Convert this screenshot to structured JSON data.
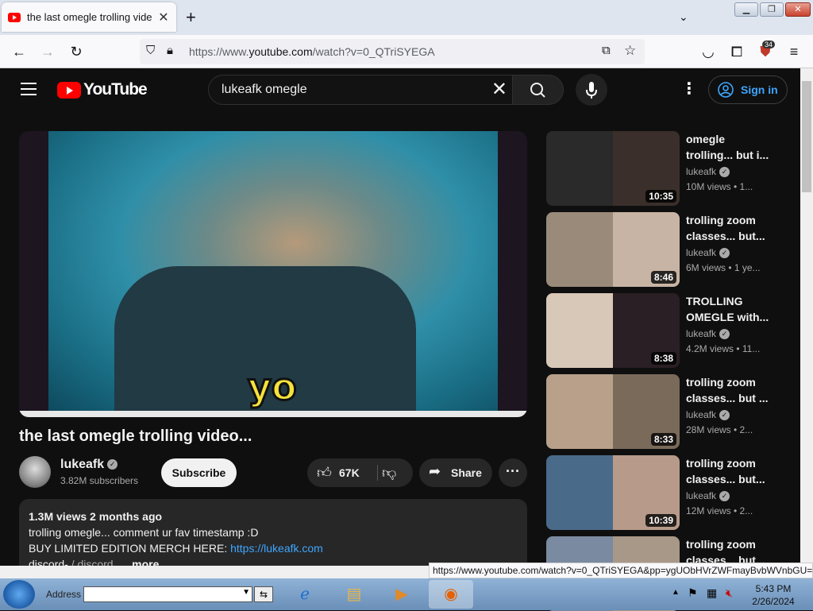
{
  "browser": {
    "tab_title": "the last omegle trolling video...",
    "url_prefix": "https://www.",
    "url_domain": "youtube.com",
    "url_rest": "/watch?v=0_QTriSYEGA",
    "extension_badge": "34",
    "status_url": "https://www.youtube.com/watch?v=0_QTriSYEGA&pp=ygUObHVrZWFmayBvbWVnbGU="
  },
  "youtube": {
    "logo_text": "YouTube",
    "search_query": "lukeafk omegle",
    "sign_in": "Sign in",
    "video": {
      "caption": "yo",
      "title": "the last omegle trolling video...",
      "channel": "lukeafk",
      "subscribers": "3.82M subscribers",
      "subscribe": "Subscribe",
      "likes": "67K",
      "share": "Share",
      "views_date": "1.3M views  2 months ago",
      "desc_line1": "trolling omegle... comment ur fav timestamp :D",
      "desc_line2_text": "BUY LIMITED EDITION MERCH HERE: ",
      "desc_line2_link": "https://lukeafk.com",
      "desc_line3": "discord- ",
      "desc_line3_link": "/ discord",
      "desc_more": "...more"
    },
    "recommendations": [
      {
        "title": "omegle trolling... but i...",
        "channel": "lukeafk",
        "stats": "10M views  • 1...",
        "duration": "10:35",
        "colors": [
          "#2a2a2a",
          "#3a2f2a"
        ]
      },
      {
        "title": "trolling zoom classes... but...",
        "channel": "lukeafk",
        "stats": "6M views  • 1 ye...",
        "duration": "8:46",
        "colors": [
          "#9a8a7a",
          "#c8b4a4"
        ]
      },
      {
        "title": "TROLLING OMEGLE with...",
        "channel": "lukeafk",
        "stats": "4.2M views  • 11...",
        "duration": "8:38",
        "colors": [
          "#d8c8b8",
          "#2a1f24"
        ]
      },
      {
        "title": "trolling zoom classes... but ...",
        "channel": "lukeafk",
        "stats": "28M views  • 2...",
        "duration": "8:33",
        "colors": [
          "#b8a08a",
          "#7a6a5a"
        ]
      },
      {
        "title": "trolling zoom classes... but...",
        "channel": "lukeafk",
        "stats": "12M views  • 2...",
        "duration": "10:39",
        "colors": [
          "#4a6a8a",
          "#b89a8a"
        ]
      },
      {
        "title": "trolling zoom classes... but...",
        "channel": "",
        "stats": "",
        "duration": "",
        "colors": [
          "#7a8aa0",
          "#a89888"
        ]
      }
    ]
  },
  "taskbar": {
    "address_label": "Address",
    "time": "5:43 PM",
    "date": "2/26/2024"
  }
}
